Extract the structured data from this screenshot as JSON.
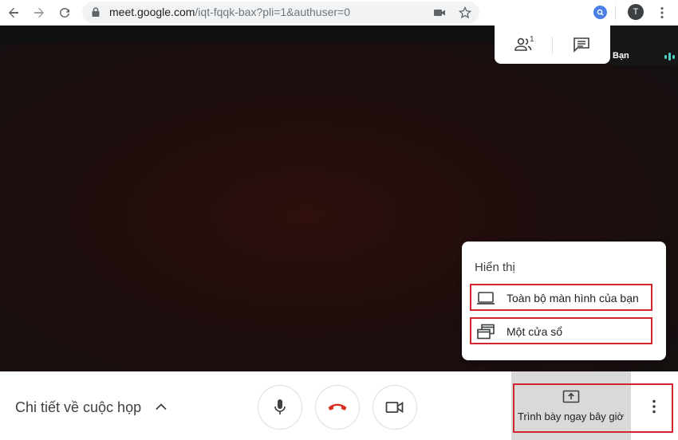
{
  "browser": {
    "url_host": "meet.google.com",
    "url_path": "/iqt-fqqk-bax?pli=1&authuser=0",
    "avatar_initial": "T",
    "icons": [
      "back-arrow-icon",
      "forward-arrow-icon",
      "reload-icon",
      "lock-icon",
      "camera-icon",
      "star-icon",
      "extension-icon",
      "kebab-menu-icon"
    ]
  },
  "meeting": {
    "participant_count": "1",
    "self_label": "Bạn",
    "icons": [
      "people-icon",
      "chat-icon",
      "audio-level-icon"
    ]
  },
  "present_menu": {
    "title": "Hiển thị",
    "items": [
      {
        "label": "Toàn bộ màn hình của bạn",
        "icon": "laptop-icon"
      },
      {
        "label": "Một cửa sổ",
        "icon": "window-icon"
      }
    ]
  },
  "bottom_bar": {
    "details_label": "Chi tiết về cuộc họp",
    "present_label": "Trình bày ngay bây giờ",
    "icons": [
      "chevron-up-icon",
      "microphone-icon",
      "hang-up-icon",
      "video-camera-icon",
      "present-screen-icon",
      "more-options-icon"
    ]
  },
  "colors": {
    "highlight_outline": "#d0262f",
    "hang_up": "#d93025",
    "audio_indicator": "#4ecdc4",
    "present_area": "#d9d9d9"
  }
}
